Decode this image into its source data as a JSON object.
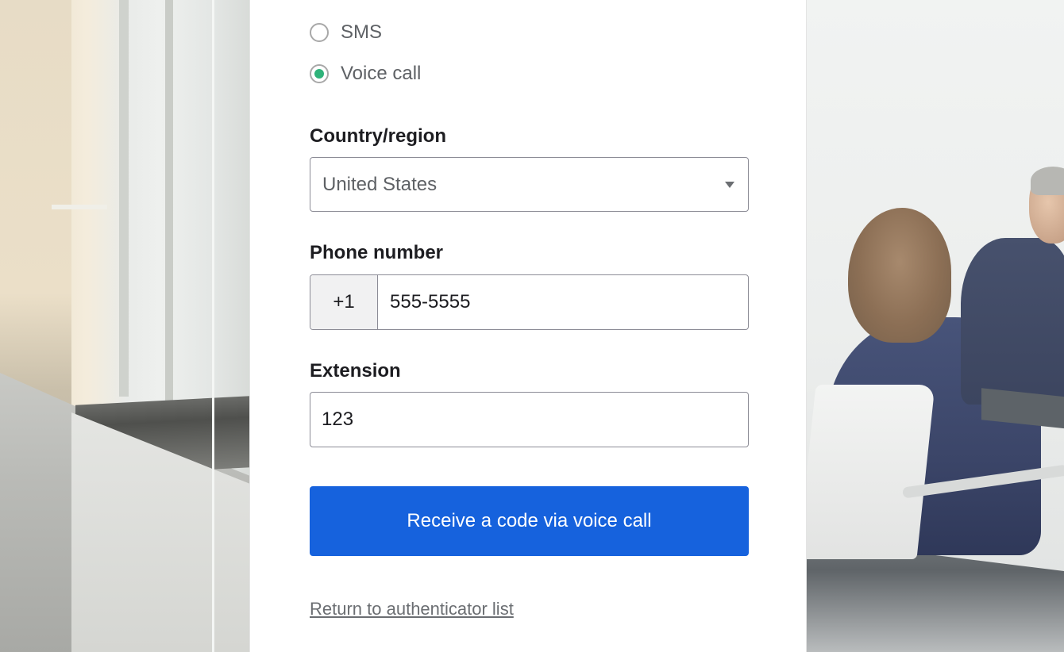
{
  "factor_options": [
    {
      "label": "SMS",
      "selected": false
    },
    {
      "label": "Voice call",
      "selected": true
    }
  ],
  "country": {
    "label": "Country/region",
    "value": "United States"
  },
  "phone": {
    "label": "Phone number",
    "prefix": "+1",
    "value": "555-5555"
  },
  "extension": {
    "label": "Extension",
    "value": "123"
  },
  "submit": {
    "label": "Receive a code via voice call"
  },
  "return_link": {
    "label": "Return to authenticator list"
  },
  "colors": {
    "primary_button": "#1662dd",
    "radio_selected": "#2fb37a"
  }
}
